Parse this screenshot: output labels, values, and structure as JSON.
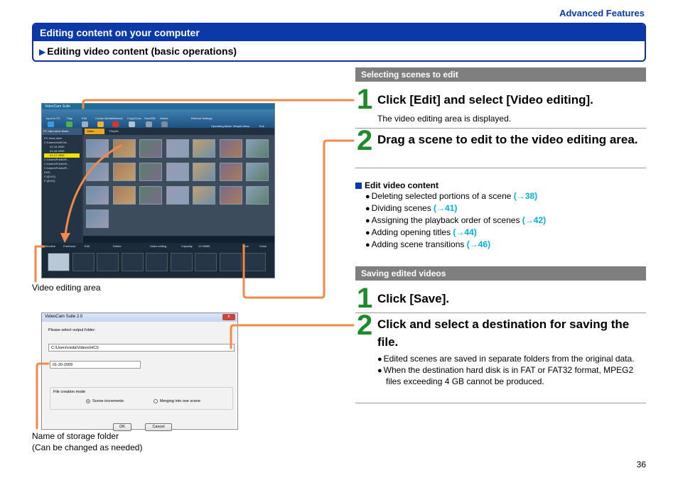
{
  "section_tag": "Advanced Features",
  "header": {
    "title": "Editing content on your computer",
    "subtitle": "Editing video content (basic operations)"
  },
  "section1": {
    "bar": "Selecting scenes to edit",
    "step1": {
      "num": "1",
      "title": "Click [Edit] and select [Video editing].",
      "desc": "The video editing area is displayed."
    },
    "step2": {
      "num": "2",
      "title": "Drag a scene to edit to the video editing area."
    },
    "edit_content": {
      "heading": "Edit video content",
      "items": [
        {
          "text": "Deleting selected portions of a scene ",
          "ref": "(→38)"
        },
        {
          "text": "Dividing scenes ",
          "ref": "(→41)"
        },
        {
          "text": "Assigning the playback order of scenes ",
          "ref": "(→42)"
        },
        {
          "text": "Adding opening titles ",
          "ref": "(→44)"
        },
        {
          "text": "Adding scene transitions ",
          "ref": "(→46)"
        }
      ]
    }
  },
  "section2": {
    "bar": "Saving edited videos",
    "step1": {
      "num": "1",
      "title": "Click [Save]."
    },
    "step2": {
      "num": "2",
      "title": "Click and select a destination for saving the file."
    },
    "notes": [
      "Edited scenes are saved in separate folders from the original data.",
      "When the destination hard disk is in FAT or FAT32 format, MPEG2 files exceeding 4 GB cannot be produced."
    ]
  },
  "screenshot1": {
    "app_title": "VideoCam Suite",
    "toolbar": [
      "Input to PC",
      "Play",
      "Edit",
      "Create Media",
      "Network",
      "Copy/Conv.",
      "Save/BD",
      "Delete"
    ],
    "right_toolbar": [
      "Refresh Settings",
      "Operating Mode: Simple Menu",
      "Exit"
    ],
    "mode": "PC hard drive Mode",
    "tree": [
      "PC Hard drive",
      "C:\\Users\\Visit\\Vid...",
      "01-15-2009",
      "01-16-2009",
      "01-17-2009",
      "C:\\Users\\Public\\Pi...",
      "C:\\Users\\Public\\Vi...",
      "C:\\Users\\Public\\Pi...",
      "DVD",
      "C:\\[DVD]",
      "F:\\[DVD]"
    ],
    "tabs": [
      "Video",
      "Playlist"
    ],
    "edit_bar": [
      "Timeline",
      "Freehand",
      "Edit",
      "Delete",
      "Video editing",
      "Capacity",
      "12.09MB",
      "Save",
      "Close"
    ]
  },
  "screenshot2": {
    "title": "VideoCam Suite 2.0",
    "close": "x",
    "prompt": "Please select output folder:",
    "path": "C:\\Users\\visita\\Videos\\HCS",
    "folder_name": "01-20-2009",
    "mode_label": "File creation mode",
    "option1": "Scene increments",
    "option2": "Merging into one scene",
    "ok": "OK",
    "cancel": "Cancel"
  },
  "captions": {
    "video_editing_area": "Video editing area",
    "storage_folder": "Name of storage folder",
    "storage_folder_note": "(Can be changed as needed)"
  },
  "page_number": "36",
  "colors": {
    "accent_blue": "#0b3aa8",
    "step_green": "#1e8a2a",
    "link_cyan": "#00aee0",
    "connector_orange": "#f08a4b"
  }
}
